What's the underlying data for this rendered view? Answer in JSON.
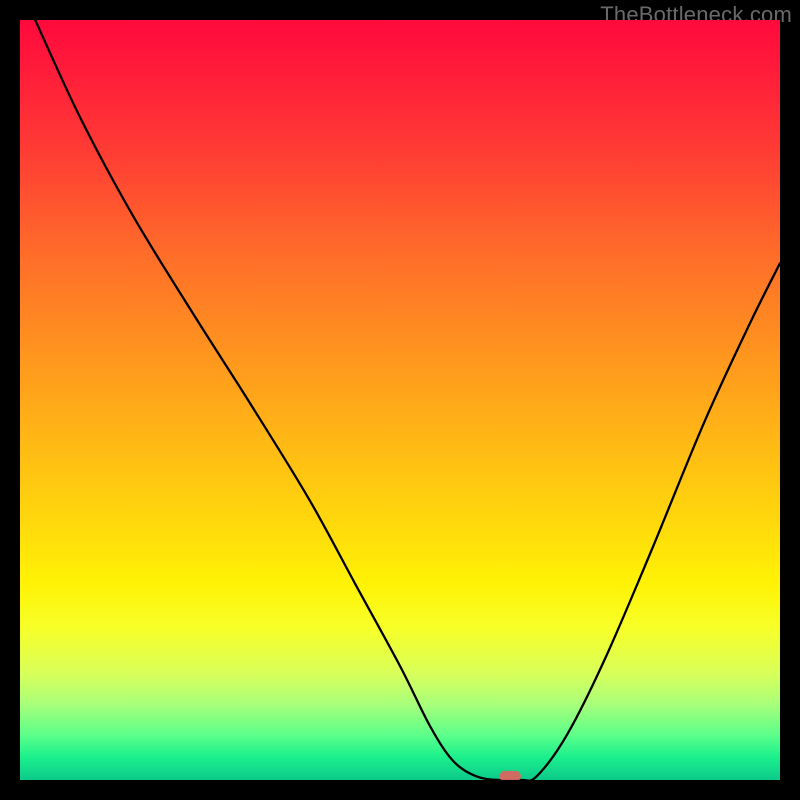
{
  "watermark": {
    "text": "TheBottleneck.com"
  },
  "chart_data": {
    "type": "line",
    "title": "",
    "xlabel": "",
    "ylabel": "",
    "xlim": [
      0,
      1000
    ],
    "ylim": [
      0,
      1000
    ],
    "grid": false,
    "legend": false,
    "background": {
      "type": "vertical-gradient",
      "stops": [
        {
          "pos": 0.0,
          "color": "#ff0a3c"
        },
        {
          "pos": 0.18,
          "color": "#ff3e34"
        },
        {
          "pos": 0.42,
          "color": "#ff8f20"
        },
        {
          "pos": 0.66,
          "color": "#ffd80c"
        },
        {
          "pos": 0.8,
          "color": "#f7ff28"
        },
        {
          "pos": 0.94,
          "color": "#5eff8a"
        },
        {
          "pos": 1.0,
          "color": "#0cc98a"
        }
      ]
    },
    "series": [
      {
        "name": "bottleneck-curve",
        "x": [
          20,
          80,
          150,
          230,
          300,
          380,
          440,
          500,
          540,
          570,
          600,
          630,
          660,
          680,
          720,
          770,
          830,
          900,
          960,
          1000
        ],
        "y": [
          1000,
          870,
          740,
          610,
          500,
          370,
          260,
          150,
          70,
          25,
          5,
          0,
          0,
          5,
          60,
          160,
          300,
          470,
          600,
          680
        ]
      }
    ],
    "annotations": [
      {
        "type": "marker",
        "name": "optimal-point",
        "x": 645,
        "y": 0,
        "color": "#e4605c",
        "shape": "pill"
      }
    ],
    "notes": "Curve depicts bottleneck severity vs. component balance. Y-axis is implied severity (high at top/red, zero at bottom/green). X-axis is implied component performance ratio. Minimum (optimal) around x≈640-660. Values are estimated from pixel positions; the source chart has no numeric axis labels."
  }
}
